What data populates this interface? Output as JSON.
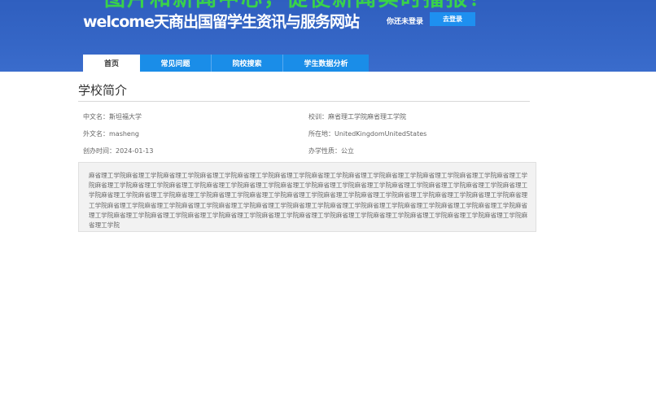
{
  "header": {
    "slogan": "图片和新闻中心，促使新闻实时播报！",
    "site_title": "welcome天商出国留学生资讯与服务网站",
    "login_status": "你还未登录",
    "login_button": "去登录"
  },
  "nav": {
    "tabs": [
      {
        "label": "首页",
        "active": true
      },
      {
        "label": "常见问题",
        "active": false
      },
      {
        "label": "院校搜索",
        "active": false
      },
      {
        "label": "学生数据分析",
        "active": false
      }
    ]
  },
  "school": {
    "section_title": "学校简介",
    "chinese_name": "中文名：斯坦福大学",
    "motto": "校训：麻省理工学院麻省理工学院",
    "foreign_name": "外文名：masheng",
    "location": "所在地：UnitedKingdomUnitedStates",
    "founded": "创办时间：2024-01-13",
    "school_type": "办学性质：公立",
    "description": "麻省理工学院麻省理工学院麻省理工学院麻省理工学院麻省理工学院麻省理工学院麻省理工学院麻省理工学院麻省理工学院麻省理工学院麻省理工学院麻省理工学院麻省理工学院麻省理工学院麻省理工学院麻省理工学院麻省理工学院麻省理工学院麻省理工学院麻省理工学院麻省理工学院麻省理工学院麻省理工学院麻省理工学院麻省理工学院麻省理工学院麻省理工学院麻省理工学院麻省理工学院麻省理工学院麻省理工学院麻省理工学院麻省理工学院麻省理工学院麻省理工学院麻省理工学院麻省理工学院麻省理工学院麻省理工学院麻省理工学院麻省理工学院麻省理工学院麻省理工学院麻省理工学院麻省理工学院麻省理工学院麻省理工学院麻省理工学院麻省理工学院麻省理工学院麻省理工学院麻省理工学院麻省理工学院麻省理工学院麻省理工学院麻省理工学院麻省理工学院麻省理工学院麻省理工学院麻省理工学院"
  },
  "colors": {
    "header_blue": "#3566c6",
    "slogan_green": "#39d24a",
    "tab_blue": "#1a8de8",
    "login_button_blue": "#1e90f0"
  }
}
